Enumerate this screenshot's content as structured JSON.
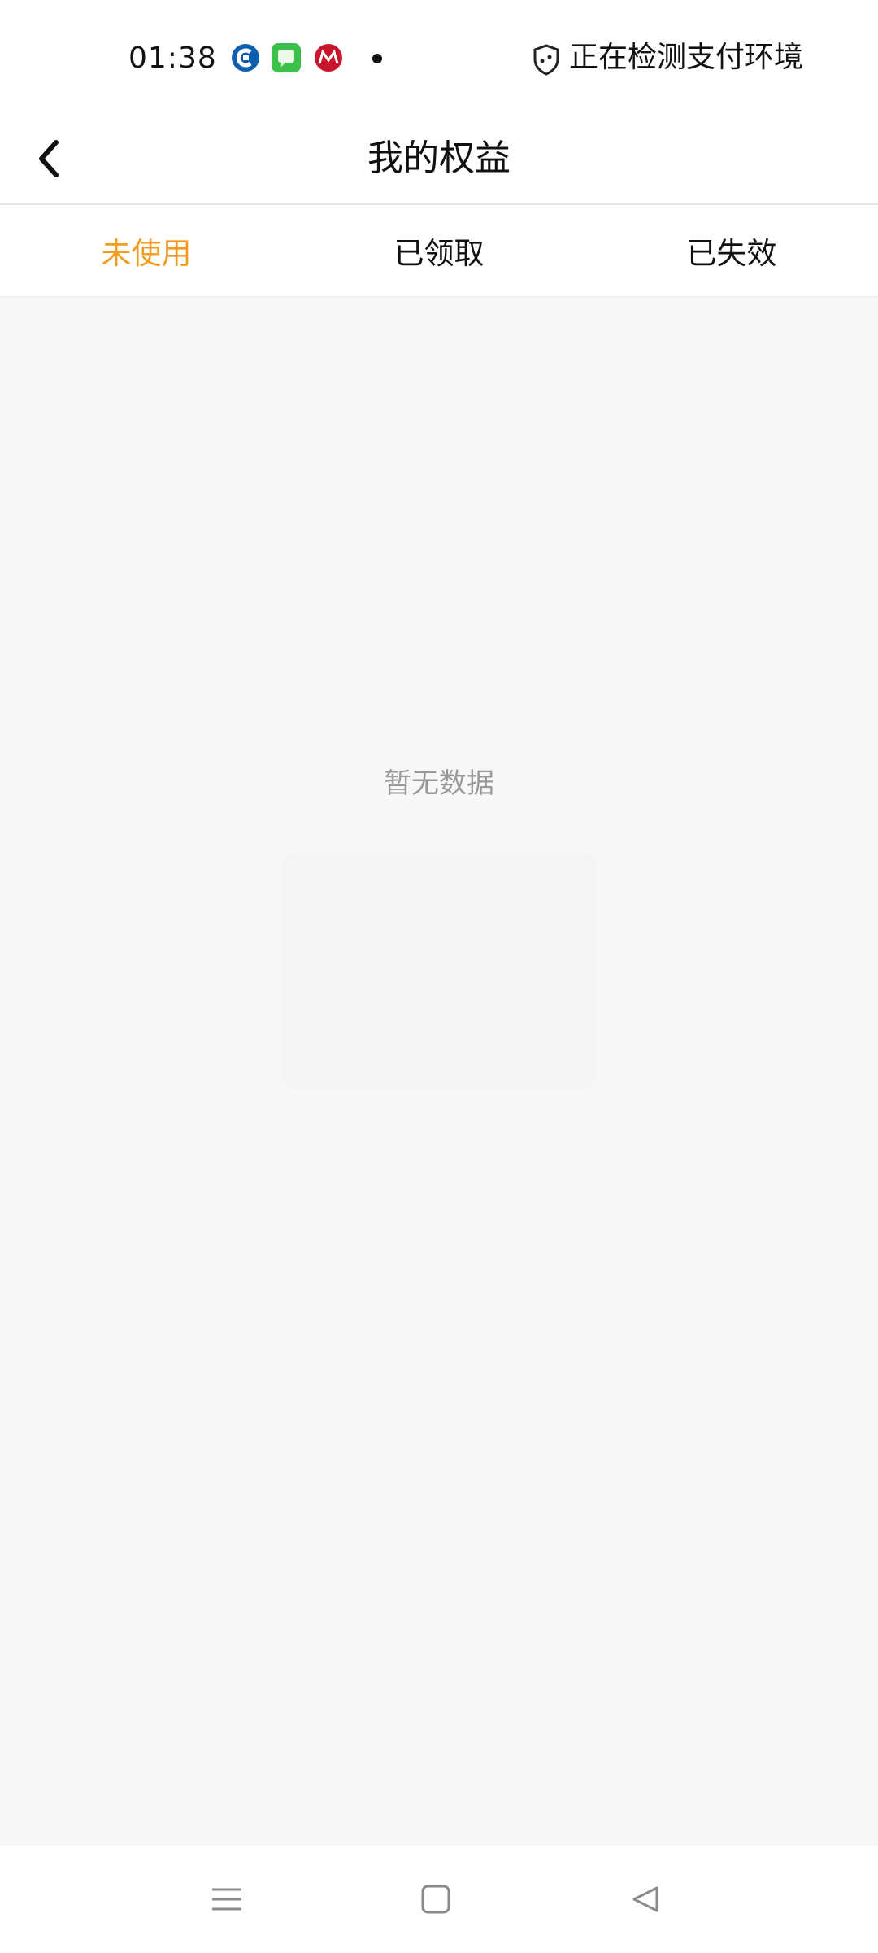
{
  "status_bar": {
    "time": "01:38",
    "status_text": "正在检测支付环境",
    "icons": [
      "ccb-app-icon",
      "messages-app-icon",
      "cmb-app-icon",
      "notification-dot-icon",
      "shield-icon"
    ]
  },
  "header": {
    "title": "我的权益",
    "back_icon": "chevron-left-icon"
  },
  "tabs": [
    {
      "label": "未使用",
      "active": true
    },
    {
      "label": "已领取",
      "active": false
    },
    {
      "label": "已失效",
      "active": false
    }
  ],
  "empty_state": {
    "message": "暂无数据"
  },
  "nav_bar": {
    "icons": [
      "menu-icon",
      "home-square-icon",
      "back-triangle-icon"
    ]
  },
  "colors": {
    "accent": "#f29b1f",
    "background": "#f7f7f7",
    "muted_text": "#999999"
  }
}
